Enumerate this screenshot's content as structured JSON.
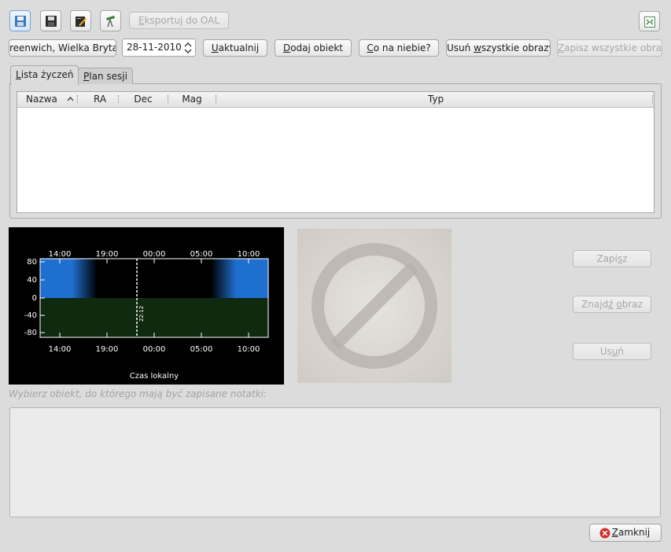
{
  "toolbar": {
    "export_label": "Eksportuj do OAL",
    "export_mnemonic": "E",
    "export_rest": "ksportuj do OAL"
  },
  "location": {
    "value": "reenwich, Wielka Brytan"
  },
  "date": {
    "value": "28-11-2010"
  },
  "actions": {
    "update_pre": "",
    "update_mn": "U",
    "update_post": "aktualnij",
    "add_pre": "",
    "add_mn": "D",
    "add_post": "odaj obiekt",
    "sky_pre": "",
    "sky_mn": "C",
    "sky_post": "o na niebie?",
    "remove_all_pre": "Usuń ",
    "remove_all_mn": "w",
    "remove_all_post": "szystkie obrazy",
    "save_all_pre": "",
    "save_all_mn": "Z",
    "save_all_post": "apisz wszystkie obrazy"
  },
  "tabs": [
    {
      "pre": "",
      "mn": "L",
      "post": "ista życzeń"
    },
    {
      "pre": "",
      "mn": "P",
      "post": "lan sesji"
    }
  ],
  "table": {
    "columns": [
      "Nazwa",
      "RA",
      "Dec",
      "Mag",
      "Typ"
    ],
    "rows": []
  },
  "altitude_chart": {
    "top_ticks": [
      "14:00",
      "19:00",
      "00:00",
      "05:00",
      "10:00"
    ],
    "bottom_ticks": [
      "14:00",
      "19:00",
      "00:00",
      "05:00",
      "10:00"
    ],
    "y_ticks": [
      "80",
      "40",
      "0",
      "-40",
      "-80"
    ],
    "current_time_label": "22:12",
    "xlabel": "Czas lokalny",
    "colors": {
      "sky": "#1f6fd1",
      "ground": "#0f2a0f",
      "background": "#000000"
    }
  },
  "side_buttons": {
    "save_pre": "Zapi",
    "save_mn": "s",
    "save_post": "z",
    "find_pre": "Znajd",
    "find_mn": "ź",
    "find_mid": " ",
    "find_mn2": "o",
    "find_post": "braz",
    "delete_pre": "Us",
    "delete_mn": "u",
    "delete_post": "ń"
  },
  "notes": {
    "placeholder": "Wybierz obiekt, do którego mają być zapisane notatki:"
  },
  "close": {
    "pre": "",
    "mn": "Z",
    "post": "amknij",
    "icon": "close-circle-icon"
  }
}
